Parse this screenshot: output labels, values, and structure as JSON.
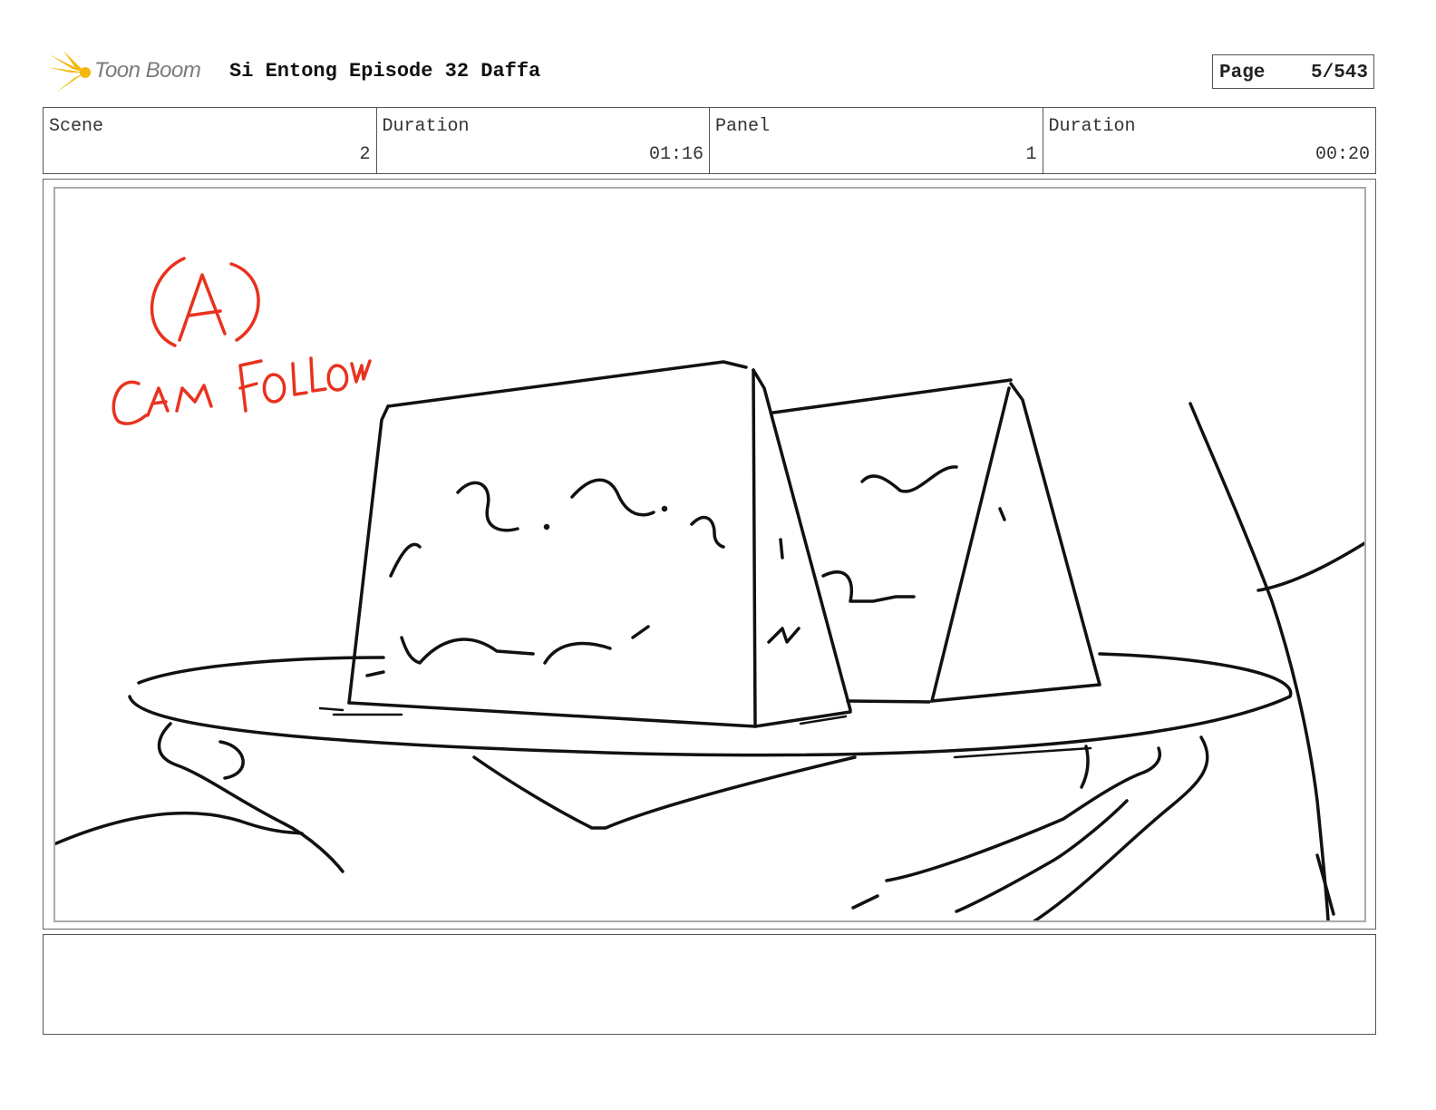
{
  "header": {
    "logo_text": "Toon Boom",
    "title": "Si Entong Episode 32 Daffa",
    "page_label": "Page",
    "page_value": "5/543"
  },
  "info": {
    "scene_label": "Scene",
    "scene_value": "2",
    "scene_duration_label": "Duration",
    "scene_duration_value": "01:16",
    "panel_label": "Panel",
    "panel_value": "1",
    "panel_duration_label": "Duration",
    "panel_duration_value": "00:20"
  },
  "sketch": {
    "annotation_letter": "A",
    "annotation_text": "CAM FOLLOW",
    "annotation_color": "#e8321e",
    "line_color": "#111111"
  },
  "notes": {
    "text": ""
  }
}
